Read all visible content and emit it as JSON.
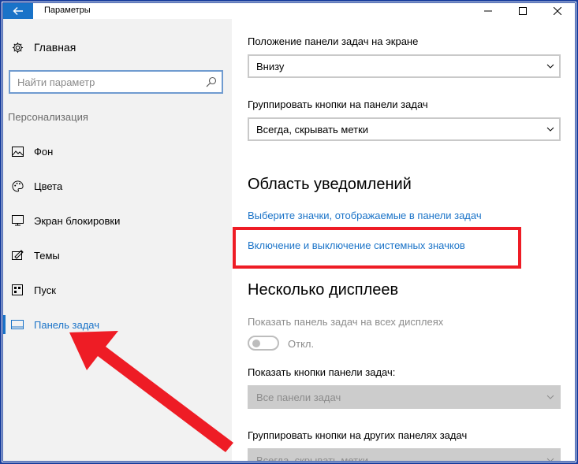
{
  "window": {
    "title": "Параметры",
    "back_icon": "arrow-left-icon",
    "minimize_icon": "minimize-icon",
    "maximize_icon": "maximize-icon",
    "close_icon": "close-icon",
    "accent_color": "#1a73c8"
  },
  "sidebar": {
    "home_label": "Главная",
    "search_placeholder": "Найти параметр",
    "section_title": "Персонализация",
    "items": [
      {
        "label": "Фон",
        "icon": "image-icon"
      },
      {
        "label": "Цвета",
        "icon": "palette-icon"
      },
      {
        "label": "Экран блокировки",
        "icon": "lock-screen-icon"
      },
      {
        "label": "Темы",
        "icon": "themes-icon"
      },
      {
        "label": "Пуск",
        "icon": "start-icon"
      },
      {
        "label": "Панель задач",
        "icon": "taskbar-icon",
        "active": true
      }
    ]
  },
  "main": {
    "taskbar_position_label": "Положение панели задач на экране",
    "taskbar_position_value": "Внизу",
    "group_buttons_label": "Группировать кнопки на панели задач",
    "group_buttons_value": "Всегда, скрывать метки",
    "notification_heading": "Область уведомлений",
    "link_select_icons": "Выберите значки, отображаемые в панели задач",
    "link_system_icons": "Включение и выключение системных значков",
    "multiple_displays_heading": "Несколько дисплеев",
    "show_taskbar_all_label": "Показать панель задач на всех дисплеях",
    "toggle_state": "Откл.",
    "show_buttons_label": "Показать кнопки панели задач:",
    "show_buttons_value": "Все панели задач",
    "group_other_label": "Группировать кнопки на других панелях задач",
    "group_other_value": "Всегда, скрывать метки"
  },
  "annotations": {
    "highlight_color": "#ee1c25"
  }
}
